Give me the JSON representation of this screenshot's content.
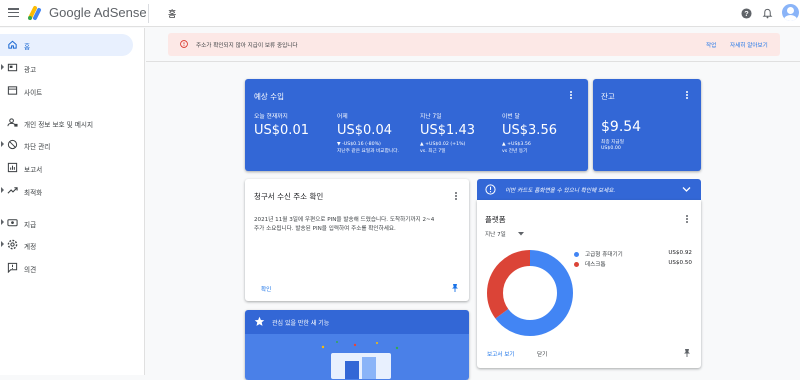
{
  "header": {
    "product_name": "Google AdSense",
    "page_title": "홈",
    "icons": [
      "menu-icon",
      "help-icon",
      "notifications-icon",
      "account-avatar"
    ]
  },
  "sidebar": {
    "items": [
      {
        "label": "홈",
        "icon": "home-icon",
        "active": true,
        "expandable": false
      },
      {
        "label": "광고",
        "icon": "ads-icon",
        "active": false,
        "expandable": true
      },
      {
        "label": "사이트",
        "icon": "sites-icon",
        "active": false,
        "expandable": false
      },
      {
        "label": "개인 정보 보호 및 메시지",
        "icon": "privacy-icon",
        "active": false,
        "expandable": false
      },
      {
        "label": "차단 관리",
        "icon": "block-icon",
        "active": false,
        "expandable": true
      },
      {
        "label": "보고서",
        "icon": "reports-icon",
        "active": false,
        "expandable": false
      },
      {
        "label": "최적화",
        "icon": "optimization-icon",
        "active": false,
        "expandable": true
      },
      {
        "label": "지급",
        "icon": "payments-icon",
        "active": false,
        "expandable": true
      },
      {
        "label": "계정",
        "icon": "account-settings-icon",
        "active": false,
        "expandable": true
      },
      {
        "label": "의견",
        "icon": "feedback-icon",
        "active": false,
        "expandable": false
      }
    ]
  },
  "alert": {
    "icon": "error-icon",
    "text": "주소가 확인되지 않아 지급이 보류 중입니다",
    "action_label": "작업",
    "learn_more_label": "자세히 알아보기"
  },
  "earnings_card": {
    "title": "예상 수입",
    "columns": [
      {
        "label": "오늘 현재까지",
        "value": "US$0.01",
        "sub1": "",
        "sub2": ""
      },
      {
        "label": "어제",
        "value": "US$0.04",
        "sub1": "▼ -US$0.16 (-80%)",
        "sub2": "지난주 같은 요일과 비교합니다."
      },
      {
        "label": "지난 7일",
        "value": "US$1.43",
        "sub1": "▲ +US$0.02 (+1%)",
        "sub2": "vs. 최근 7일"
      },
      {
        "label": "이번 달",
        "value": "US$3.56",
        "sub1": "▲ +US$3.56",
        "sub2": "vs 전년 동기"
      }
    ]
  },
  "balance_card": {
    "title": "잔고",
    "value": "$9.54",
    "last_payment_label": "최종 지급일",
    "last_payment_value": "US$0.00"
  },
  "address_card": {
    "title": "청구서 수신 주소 확인",
    "body_line1": "2021년 11월 3일에 우편으로 PIN을 발송해 드렸습니다. 도착하기까지 2~4",
    "body_line2": "주가 소요됩니다. 발송된 PIN을 입력하여 주소를 확인하세요.",
    "action_label": "확인",
    "pin_icon": "pin-icon"
  },
  "features_card": {
    "title": "관심 있을 만한 새 기능",
    "icon": "star-icon"
  },
  "platform_banner": {
    "text": "이번 카드도 홈화면을 수 있으니 확인해 보세요.",
    "icon": "info-icon",
    "chevron": "chevron-down-icon"
  },
  "platform_card": {
    "title": "플랫폼",
    "range_label": "지난 7일",
    "report_label": "보고서 보기",
    "close_label": "닫기",
    "legend": [
      {
        "name": "고급형 휴대기기",
        "value": "US$0.92",
        "color": "#4285f4"
      },
      {
        "name": "데스크톱",
        "value": "US$0.50",
        "color": "#db4437"
      }
    ]
  },
  "chart_data": {
    "type": "pie",
    "categories": [
      "고급형 휴대기기",
      "데스크톱"
    ],
    "values": [
      0.92,
      0.5
    ],
    "colors": [
      "#4285f4",
      "#db4437"
    ]
  },
  "colors": {
    "accent": "#1a73e8",
    "card_blue": "#3367d6",
    "alert_bg": "#fce8e6",
    "active_nav_bg": "#e8f0fe"
  }
}
